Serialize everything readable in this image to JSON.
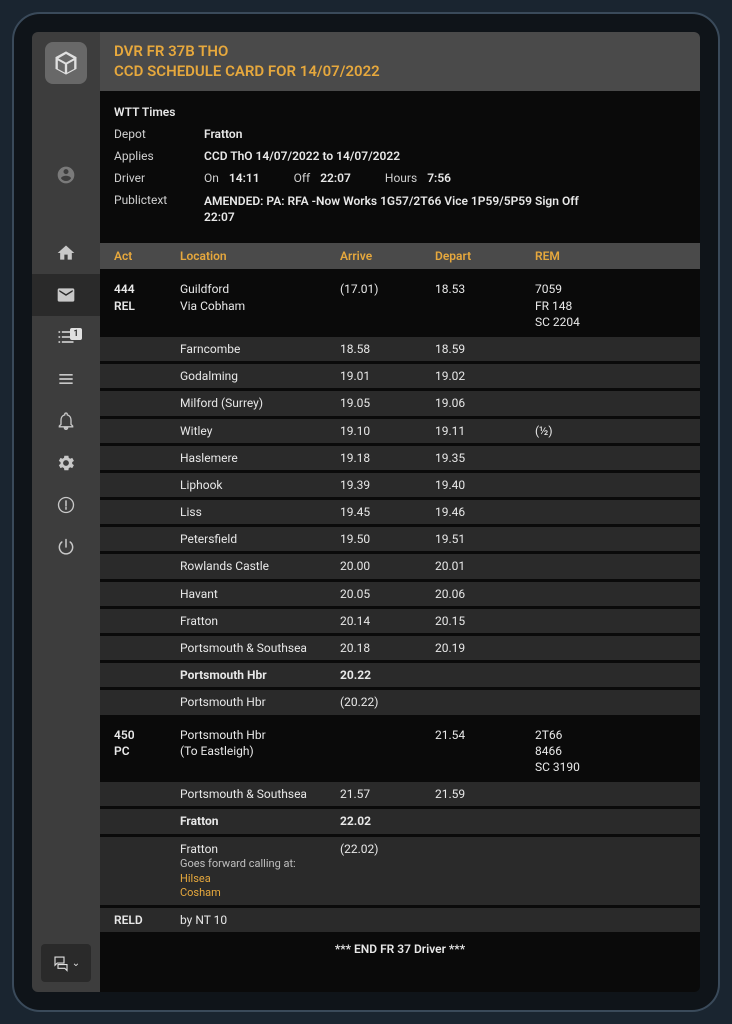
{
  "header": {
    "line1": "DVR FR 37B THO",
    "line2": "CCD SCHEDULE CARD FOR 14/07/2022"
  },
  "meta": {
    "wtt": "WTT Times",
    "depot_label": "Depot",
    "depot_value": "Fratton",
    "applies_label": "Applies",
    "applies_value": "CCD ThO 14/07/2022 to 14/07/2022",
    "driver_label": "Driver",
    "on_label": "On",
    "on_value": "14:11",
    "off_label": "Off",
    "off_value": "22:07",
    "hours_label": "Hours",
    "hours_value": "7:56",
    "publictext_label": "Publictext",
    "publictext_value": "AMENDED: PA: RFA -Now Works 1G57/2T66 Vice 1P59/5P59 Sign Off 22:07"
  },
  "columns": {
    "act": "Act",
    "loc": "Location",
    "arr": "Arrive",
    "dep": "Depart",
    "rem": "REM"
  },
  "rows": [
    {
      "section": true,
      "act": "444\nREL",
      "loc": "Guildford\nVia Cobham",
      "arr": "(17.01)",
      "dep": "18.53",
      "rem": "7059\nFR 148\nSC 2204"
    },
    {
      "act": "",
      "loc": "Farncombe",
      "arr": "18.58",
      "dep": "18.59",
      "rem": ""
    },
    {
      "act": "",
      "loc": "Godalming",
      "arr": "19.01",
      "dep": "19.02",
      "rem": ""
    },
    {
      "act": "",
      "loc": "Milford (Surrey)",
      "arr": "19.05",
      "dep": "19.06",
      "rem": ""
    },
    {
      "act": "",
      "loc": "Witley",
      "arr": "19.10",
      "dep": "19.11",
      "rem": "(½)"
    },
    {
      "act": "",
      "loc": "Haslemere",
      "arr": "19.18",
      "dep": "19.35",
      "rem": ""
    },
    {
      "act": "",
      "loc": "Liphook",
      "arr": "19.39",
      "dep": "19.40",
      "rem": ""
    },
    {
      "act": "",
      "loc": "Liss",
      "arr": "19.45",
      "dep": "19.46",
      "rem": ""
    },
    {
      "act": "",
      "loc": "Petersfield",
      "arr": "19.50",
      "dep": "19.51",
      "rem": ""
    },
    {
      "act": "",
      "loc": "Rowlands Castle",
      "arr": "20.00",
      "dep": "20.01",
      "rem": ""
    },
    {
      "act": "",
      "loc": "Havant",
      "arr": "20.05",
      "dep": "20.06",
      "rem": ""
    },
    {
      "act": "",
      "loc": "Fratton",
      "arr": "20.14",
      "dep": "20.15",
      "rem": ""
    },
    {
      "act": "",
      "loc": "Portsmouth & Southsea",
      "arr": "20.18",
      "dep": "20.19",
      "rem": ""
    },
    {
      "act": "",
      "loc": "Portsmouth Hbr",
      "arr": "20.22",
      "dep": "",
      "rem": "",
      "bold": true
    },
    {
      "act": "",
      "loc": "Portsmouth Hbr",
      "arr": "(20.22)",
      "dep": "",
      "rem": ""
    },
    {
      "section": true,
      "act": "450\nPC",
      "loc": "Portsmouth Hbr\n(To Eastleigh)",
      "arr": "",
      "dep": "21.54",
      "rem": "2T66\n8466\nSC 3190"
    },
    {
      "act": "",
      "loc": "Portsmouth & Southsea",
      "arr": "21.57",
      "dep": "21.59",
      "rem": ""
    },
    {
      "act": "",
      "loc": "Fratton",
      "arr": "22.02",
      "dep": "",
      "rem": "",
      "bold": true
    },
    {
      "act": "",
      "loc": "Fratton",
      "arr": "(22.02)",
      "dep": "",
      "rem": "",
      "forward": {
        "label": "Goes forward calling at:",
        "stops": [
          "Hilsea",
          "Cosham"
        ]
      }
    },
    {
      "act": "RELD",
      "loc": "by NT 10",
      "arr": "",
      "dep": "",
      "rem": ""
    }
  ],
  "endline": "*** END FR 37 Driver ***",
  "sidebar": {
    "badge": "1"
  }
}
